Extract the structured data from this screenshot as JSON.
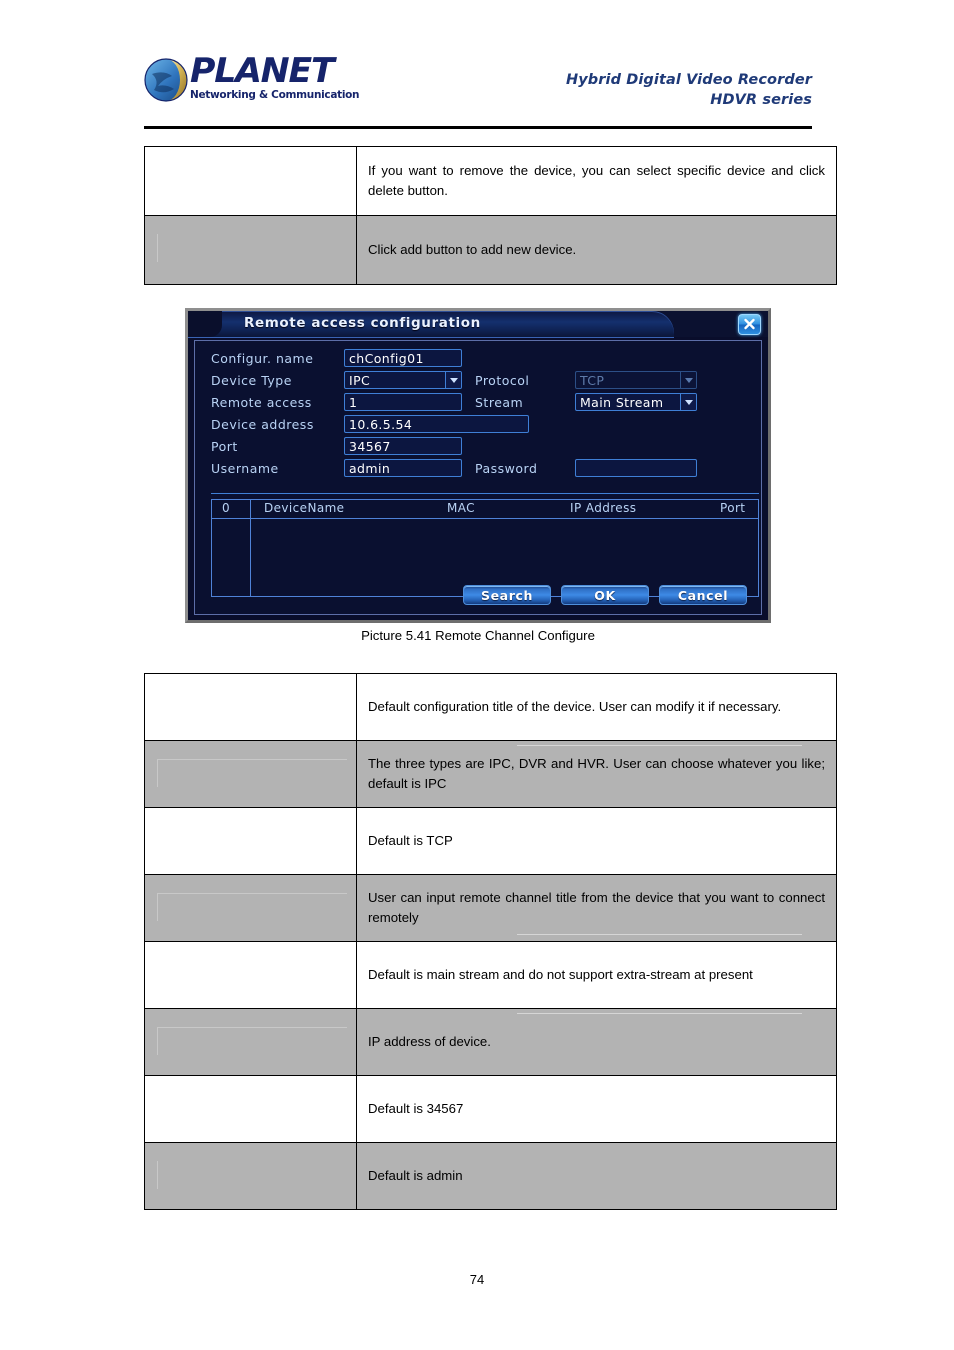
{
  "header": {
    "logo": {
      "icon": "planet-globe-icon",
      "word": "PLANET",
      "tagline": "Networking & Communication",
      "brand_color": "#16246b"
    },
    "product_line_1": "Hybrid Digital Video Recorder",
    "product_line_2": "HDVR series",
    "product_color": "#1f3a78"
  },
  "top_table": {
    "rows": [
      {
        "left": "",
        "right": "If you want to remove the device, you can select specific device and click delete button.",
        "shade": "white"
      },
      {
        "left": "",
        "right": "Click add button to add new device.",
        "shade": "gray"
      }
    ]
  },
  "dialog": {
    "title": "Remote access configuration",
    "close_icon": "close-x-icon",
    "fields": {
      "configur_name_label": "Configur. name",
      "configur_name_value": "chConfig01",
      "device_type_label": "Device Type",
      "device_type_value": "IPC",
      "protocol_label": "Protocol",
      "protocol_value": "TCP",
      "remote_access_label": "Remote access",
      "remote_access_value": "1",
      "stream_label": "Stream",
      "stream_value": "Main Stream",
      "device_address_label": "Device address",
      "device_address_value": "10.6.5.54",
      "port_label": "Port",
      "port_value": "34567",
      "username_label": "Username",
      "username_value": "admin",
      "password_label": "Password",
      "password_value": ""
    },
    "list": {
      "headers": [
        "0",
        "DeviceName",
        "MAC",
        "IP Address",
        "Port"
      ],
      "rows": []
    },
    "buttons": {
      "search": "Search",
      "ok": "OK",
      "cancel": "Cancel"
    },
    "colors": {
      "background": "#0a1030",
      "accent": "#3f7fd6",
      "label_text": "#b9d3f5",
      "disabled_text": "#5e7aa8"
    }
  },
  "figure_caption": "Picture 5.41 Remote Channel Configure",
  "bottom_table": {
    "rows": [
      {
        "left": "",
        "right": "Default configuration title of the device. User can modify it if necessary.",
        "shade": "white"
      },
      {
        "left": "",
        "right": "The three types are IPC, DVR and HVR. User can choose whatever you like; default is IPC",
        "shade": "gray"
      },
      {
        "left": "",
        "right": "Default is TCP",
        "shade": "white"
      },
      {
        "left": "",
        "right": "User can input remote channel title from the device that you want to connect remotely",
        "shade": "gray"
      },
      {
        "left": "",
        "right": "Default is main stream and do not support extra-stream at present",
        "shade": "white"
      },
      {
        "left": "",
        "right": "IP address of device.",
        "shade": "gray"
      },
      {
        "left": "",
        "right": "Default is 34567",
        "shade": "white"
      },
      {
        "left": "",
        "right": "Default is admin",
        "shade": "gray"
      }
    ]
  },
  "page_number": "74"
}
